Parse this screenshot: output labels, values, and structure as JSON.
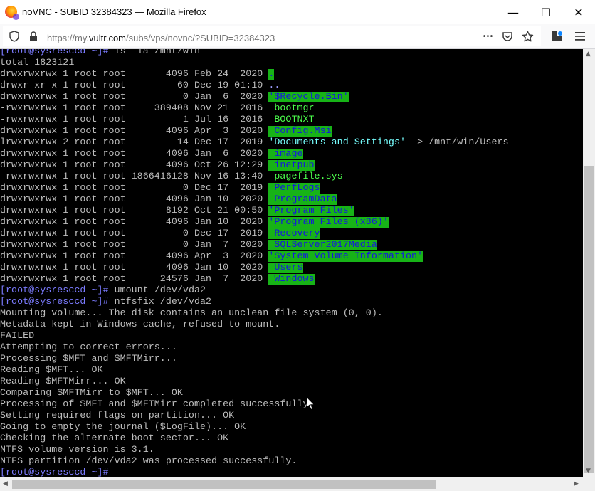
{
  "window": {
    "title": "noVNC - SUBID 32384323 — Mozilla Firefox",
    "minimize_glyph": "—",
    "maximize_glyph": "☐",
    "close_glyph": "✕"
  },
  "urlbar": {
    "prefix": "https://my.",
    "host": "vultr.com",
    "path": "/subs/vps/novnc/?SUBID=32384323",
    "more_glyph": "•••"
  },
  "icons": [
    "firefox-logo-icon",
    "shield-icon",
    "lock-icon",
    "page-actions-icon",
    "pocket-icon",
    "bookmark-star-icon",
    "extensions-icon",
    "hamburger-menu-icon",
    "mouse-cursor-icon"
  ],
  "colors": {
    "terminal_bg": "#000000",
    "terminal_fg": "#bdbdbd",
    "dir_highlight_bg": "#17b317",
    "dir_highlight_fg": "#1515e0",
    "prompt": "#7b7bff"
  },
  "terminal": {
    "header": {
      "cmd_line": {
        "prompt": "[root@sysresccd ~]#",
        "text": " ls -la /mnt/win"
      },
      "total": "total 1823121"
    },
    "listing": [
      {
        "meta": "drwxrwxrwx 1 root root       4096 Feb 24  2020 ",
        "name": ".",
        "style": "gr",
        "suffix": ""
      },
      {
        "meta": "drwxr-xr-x 1 root root         60 Dec 19 01:10 ",
        "name": "..",
        "style": "gw",
        "suffix": ""
      },
      {
        "meta": "drwxrwxrwx 1 root root          0 Jan  6  2020 ",
        "name": "'$Recycle.Bin'",
        "style": "gr",
        "suffix": ""
      },
      {
        "meta": "-rwxrwxrwx 1 root root     389408 Nov 21  2016 ",
        "name": " bootmgr",
        "style": "ex",
        "suffix": ""
      },
      {
        "meta": "-rwxrwxrwx 1 root root          1 Jul 16  2016 ",
        "name": " BOOTNXT",
        "style": "ex",
        "suffix": ""
      },
      {
        "meta": "drwxrwxrwx 1 root root       4096 Apr  3  2020 ",
        "name": " Config.Msi",
        "style": "gr",
        "suffix": ""
      },
      {
        "meta": "lrwxrwxrwx 2 root root         14 Dec 17  2019 ",
        "name": "'Documents and Settings'",
        "style": "ln",
        "suffix": " -> /mnt/win/Users"
      },
      {
        "meta": "drwxrwxrwx 1 root root       4096 Jan  6  2020 ",
        "name": " image",
        "style": "gr",
        "suffix": ""
      },
      {
        "meta": "drwxrwxrwx 1 root root       4096 Oct 26 12:29 ",
        "name": " inetpub",
        "style": "gr",
        "suffix": ""
      },
      {
        "meta": "-rwxrwxrwx 1 root root 1866416128 Nov 16 13:40 ",
        "name": " pagefile.sys",
        "style": "ex",
        "suffix": ""
      },
      {
        "meta": "drwxrwxrwx 1 root root          0 Dec 17  2019 ",
        "name": " PerfLogs",
        "style": "gr",
        "suffix": ""
      },
      {
        "meta": "drwxrwxrwx 1 root root       4096 Jan 10  2020 ",
        "name": " ProgramData",
        "style": "gr",
        "suffix": ""
      },
      {
        "meta": "drwxrwxrwx 1 root root       8192 Oct 21 00:50 ",
        "name": "'Program Files'",
        "style": "gr",
        "suffix": ""
      },
      {
        "meta": "drwxrwxrwx 1 root root       4096 Jan 10  2020 ",
        "name": "'Program Files (x86)'",
        "style": "gr",
        "suffix": ""
      },
      {
        "meta": "drwxrwxrwx 1 root root          0 Dec 17  2019 ",
        "name": " Recovery",
        "style": "gr",
        "suffix": ""
      },
      {
        "meta": "drwxrwxrwx 1 root root          0 Jan  7  2020 ",
        "name": " SQLServer2017Media",
        "style": "gr",
        "suffix": ""
      },
      {
        "meta": "drwxrwxrwx 1 root root       4096 Apr  3  2020 ",
        "name": "'System Volume Information'",
        "style": "gr",
        "suffix": ""
      },
      {
        "meta": "drwxrwxrwx 1 root root       4096 Jan 10  2020 ",
        "name": " Users",
        "style": "gr",
        "suffix": ""
      },
      {
        "meta": "drwxrwxrwx 1 root root      24576 Jan  7  2020 ",
        "name": " Windows",
        "style": "gr",
        "suffix": ""
      }
    ],
    "tail": [
      {
        "prompt": "[root@sysresccd ~]#",
        "text": " umount /dev/vda2"
      },
      {
        "prompt": "[root@sysresccd ~]#",
        "text": " ntfsfix /dev/vda2"
      },
      {
        "prompt": "",
        "text": "Mounting volume... The disk contains an unclean file system (0, 0)."
      },
      {
        "prompt": "",
        "text": "Metadata kept in Windows cache, refused to mount."
      },
      {
        "prompt": "",
        "text": "FAILED"
      },
      {
        "prompt": "",
        "text": "Attempting to correct errors..."
      },
      {
        "prompt": "",
        "text": "Processing $MFT and $MFTMirr..."
      },
      {
        "prompt": "",
        "text": "Reading $MFT... OK"
      },
      {
        "prompt": "",
        "text": "Reading $MFTMirr... OK"
      },
      {
        "prompt": "",
        "text": "Comparing $MFTMirr to $MFT... OK"
      },
      {
        "prompt": "",
        "text": "Processing of $MFT and $MFTMirr completed successfully."
      },
      {
        "prompt": "",
        "text": "Setting required flags on partition... OK"
      },
      {
        "prompt": "",
        "text": "Going to empty the journal ($LogFile)... OK"
      },
      {
        "prompt": "",
        "text": "Checking the alternate boot sector... OK"
      },
      {
        "prompt": "",
        "text": "NTFS volume version is 3.1."
      },
      {
        "prompt": "",
        "text": "NTFS partition /dev/vda2 was processed successfully."
      },
      {
        "prompt": "[root@sysresccd ~]#",
        "text": ""
      }
    ]
  }
}
